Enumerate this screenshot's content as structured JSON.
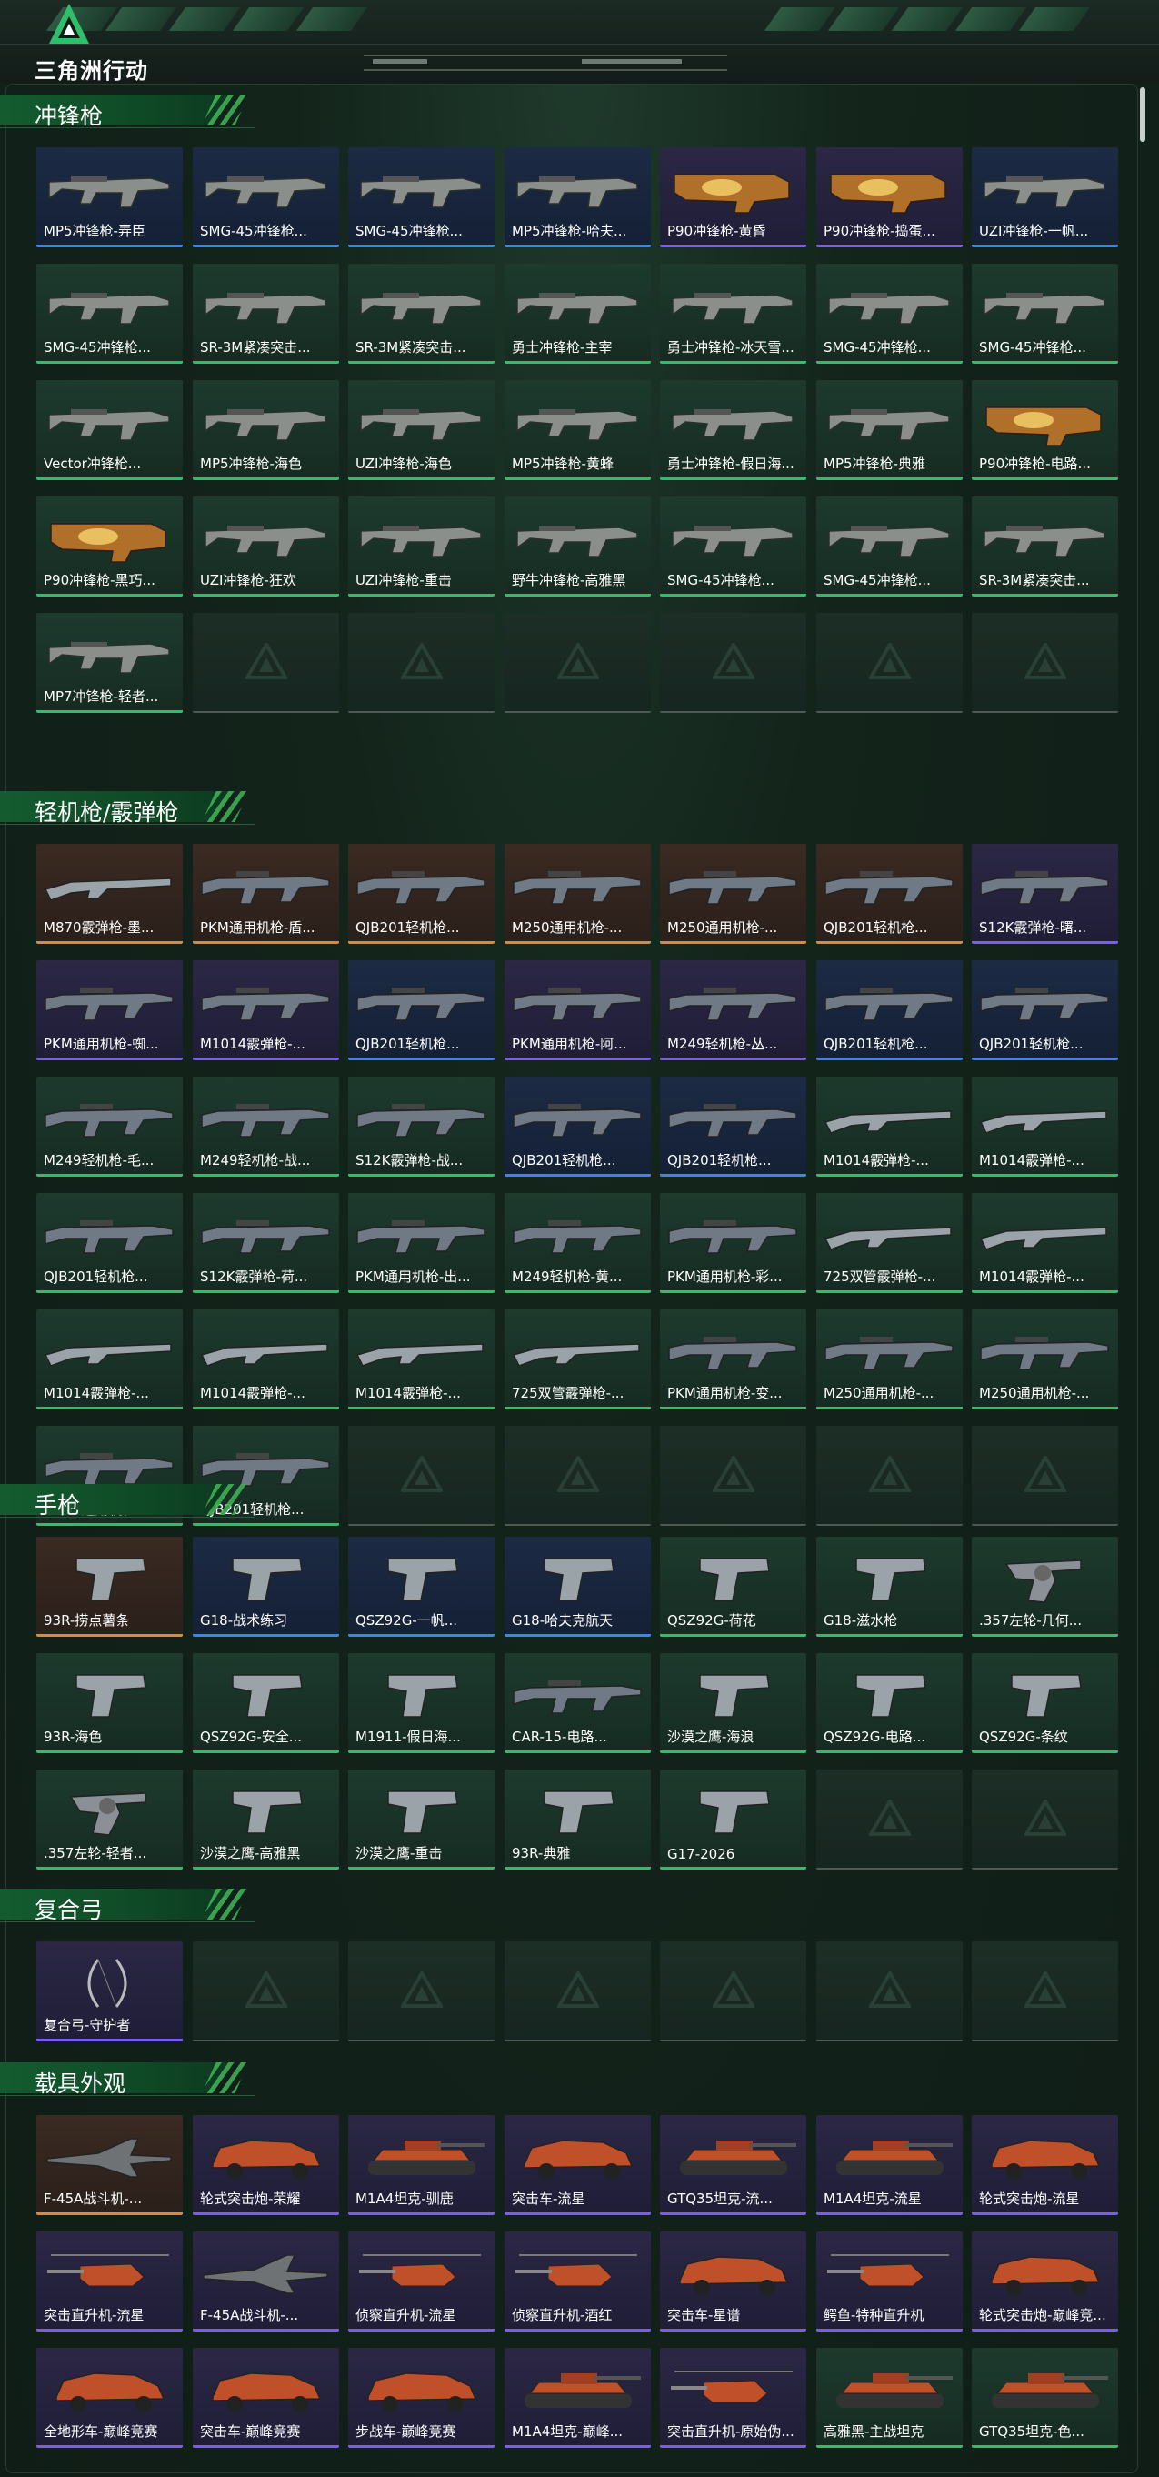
{
  "app": {
    "logo_text": "三角洲行动"
  },
  "colors": {
    "purple": "#7b5cf0",
    "blue": "#3d86e8",
    "gold": "#d98a3a",
    "green": "#2fbf6b"
  },
  "sections": [
    {
      "title": "冲锋枪",
      "items": [
        {
          "label": "MP5冲锋枪-弄臣",
          "rarity": "blue",
          "icon": "smg"
        },
        {
          "label": "SMG-45冲锋枪...",
          "rarity": "blue",
          "icon": "smg"
        },
        {
          "label": "SMG-45冲锋枪...",
          "rarity": "blue",
          "icon": "smg"
        },
        {
          "label": "MP5冲锋枪-哈夫...",
          "rarity": "blue",
          "icon": "smg"
        },
        {
          "label": "P90冲锋枪-黄昏",
          "rarity": "purple",
          "icon": "p90"
        },
        {
          "label": "P90冲锋枪-捣蛋...",
          "rarity": "purple",
          "icon": "p90"
        },
        {
          "label": "UZI冲锋枪-一帆...",
          "rarity": "blue",
          "icon": "smg"
        },
        {
          "label": "SMG-45冲锋枪...",
          "rarity": "green",
          "icon": "smg"
        },
        {
          "label": "SR-3M紧凑突击...",
          "rarity": "green",
          "icon": "smg"
        },
        {
          "label": "SR-3M紧凑突击...",
          "rarity": "green",
          "icon": "smg"
        },
        {
          "label": "勇士冲锋枪-主宰",
          "rarity": "green",
          "icon": "smg"
        },
        {
          "label": "勇士冲锋枪-冰天雪...",
          "rarity": "green",
          "icon": "smg"
        },
        {
          "label": "SMG-45冲锋枪...",
          "rarity": "green",
          "icon": "smg"
        },
        {
          "label": "SMG-45冲锋枪...",
          "rarity": "green",
          "icon": "smg"
        },
        {
          "label": "Vector冲锋枪...",
          "rarity": "green",
          "icon": "smg"
        },
        {
          "label": "MP5冲锋枪-海色",
          "rarity": "green",
          "icon": "smg"
        },
        {
          "label": "UZI冲锋枪-海色",
          "rarity": "green",
          "icon": "smg"
        },
        {
          "label": "MP5冲锋枪-黄蜂",
          "rarity": "green",
          "icon": "smg"
        },
        {
          "label": "勇士冲锋枪-假日海...",
          "rarity": "green",
          "icon": "smg"
        },
        {
          "label": "MP5冲锋枪-典雅",
          "rarity": "green",
          "icon": "smg"
        },
        {
          "label": "P90冲锋枪-电路...",
          "rarity": "green",
          "icon": "p90"
        },
        {
          "label": "P90冲锋枪-黑巧...",
          "rarity": "green",
          "icon": "p90"
        },
        {
          "label": "UZI冲锋枪-狂欢",
          "rarity": "green",
          "icon": "smg"
        },
        {
          "label": "UZI冲锋枪-重击",
          "rarity": "green",
          "icon": "smg"
        },
        {
          "label": "野牛冲锋枪-高雅黑",
          "rarity": "green",
          "icon": "smg"
        },
        {
          "label": "SMG-45冲锋枪...",
          "rarity": "green",
          "icon": "smg"
        },
        {
          "label": "SMG-45冲锋枪...",
          "rarity": "green",
          "icon": "smg"
        },
        {
          "label": "SR-3M紧凑突击...",
          "rarity": "green",
          "icon": "smg"
        },
        {
          "label": "MP7冲锋枪-轻者...",
          "rarity": "green",
          "icon": "smg"
        }
      ]
    },
    {
      "title": "轻机枪/霰弹枪",
      "items": [
        {
          "label": "M870霰弹枪-墨...",
          "rarity": "gold",
          "icon": "shotgun"
        },
        {
          "label": "PKM通用机枪-盾...",
          "rarity": "gold",
          "icon": "rifle"
        },
        {
          "label": "QJB201轻机枪...",
          "rarity": "gold",
          "icon": "rifle"
        },
        {
          "label": "M250通用机枪-...",
          "rarity": "gold",
          "icon": "rifle"
        },
        {
          "label": "M250通用机枪-...",
          "rarity": "gold",
          "icon": "rifle"
        },
        {
          "label": "QJB201轻机枪...",
          "rarity": "gold",
          "icon": "rifle"
        },
        {
          "label": "S12K霰弹枪-曙...",
          "rarity": "purple",
          "icon": "rifle"
        },
        {
          "label": "PKM通用机枪-蜘...",
          "rarity": "purple",
          "icon": "rifle"
        },
        {
          "label": "M1014霰弹枪-...",
          "rarity": "purple",
          "icon": "rifle"
        },
        {
          "label": "QJB201轻机枪...",
          "rarity": "blue",
          "icon": "rifle"
        },
        {
          "label": "PKM通用机枪-阿...",
          "rarity": "purple",
          "icon": "rifle"
        },
        {
          "label": "M249轻机枪-丛...",
          "rarity": "purple",
          "icon": "rifle"
        },
        {
          "label": "QJB201轻机枪...",
          "rarity": "blue",
          "icon": "rifle"
        },
        {
          "label": "QJB201轻机枪...",
          "rarity": "blue",
          "icon": "rifle"
        },
        {
          "label": "M249轻机枪-毛...",
          "rarity": "green",
          "icon": "rifle"
        },
        {
          "label": "M249轻机枪-战...",
          "rarity": "green",
          "icon": "rifle"
        },
        {
          "label": "S12K霰弹枪-战...",
          "rarity": "green",
          "icon": "rifle"
        },
        {
          "label": "QJB201轻机枪...",
          "rarity": "blue",
          "icon": "rifle"
        },
        {
          "label": "QJB201轻机枪...",
          "rarity": "blue",
          "icon": "rifle"
        },
        {
          "label": "M1014霰弹枪-...",
          "rarity": "green",
          "icon": "shotgun"
        },
        {
          "label": "M1014霰弹枪-...",
          "rarity": "green",
          "icon": "shotgun"
        },
        {
          "label": "QJB201轻机枪...",
          "rarity": "green",
          "icon": "rifle"
        },
        {
          "label": "S12K霰弹枪-荷...",
          "rarity": "green",
          "icon": "rifle"
        },
        {
          "label": "PKM通用机枪-出...",
          "rarity": "green",
          "icon": "rifle"
        },
        {
          "label": "M249轻机枪-黄...",
          "rarity": "green",
          "icon": "rifle"
        },
        {
          "label": "PKM通用机枪-彩...",
          "rarity": "green",
          "icon": "rifle"
        },
        {
          "label": "725双管霰弹枪-...",
          "rarity": "green",
          "icon": "shotgun"
        },
        {
          "label": "M1014霰弹枪-...",
          "rarity": "green",
          "icon": "shotgun"
        },
        {
          "label": "M1014霰弹枪-...",
          "rarity": "green",
          "icon": "shotgun"
        },
        {
          "label": "M1014霰弹枪-...",
          "rarity": "green",
          "icon": "shotgun"
        },
        {
          "label": "M1014霰弹枪-...",
          "rarity": "green",
          "icon": "shotgun"
        },
        {
          "label": "725双管霰弹枪-...",
          "rarity": "green",
          "icon": "shotgun"
        },
        {
          "label": "PKM通用机枪-变...",
          "rarity": "green",
          "icon": "rifle"
        },
        {
          "label": "M250通用机枪-...",
          "rarity": "green",
          "icon": "rifle"
        },
        {
          "label": "M250通用机枪-...",
          "rarity": "green",
          "icon": "rifle"
        },
        {
          "label": "M250通用机枪-...",
          "rarity": "green",
          "icon": "rifle"
        },
        {
          "label": "QJB201轻机枪...",
          "rarity": "green",
          "icon": "rifle"
        }
      ]
    },
    {
      "title": "手枪",
      "items": [
        {
          "label": "93R-捞点薯条",
          "rarity": "gold",
          "icon": "pistol"
        },
        {
          "label": "G18-战术练习",
          "rarity": "blue",
          "icon": "pistol"
        },
        {
          "label": "QSZ92G-一帆...",
          "rarity": "blue",
          "icon": "pistol"
        },
        {
          "label": "G18-哈夫克航天",
          "rarity": "blue",
          "icon": "pistol"
        },
        {
          "label": "QSZ92G-荷花",
          "rarity": "green",
          "icon": "pistol"
        },
        {
          "label": "G18-滋水枪",
          "rarity": "green",
          "icon": "pistol"
        },
        {
          "label": ".357左轮-几何...",
          "rarity": "green",
          "icon": "revolver"
        },
        {
          "label": "93R-海色",
          "rarity": "green",
          "icon": "pistol"
        },
        {
          "label": "QSZ92G-安全...",
          "rarity": "green",
          "icon": "pistol"
        },
        {
          "label": "M1911-假日海...",
          "rarity": "green",
          "icon": "pistol"
        },
        {
          "label": "CAR-15-电路...",
          "rarity": "green",
          "icon": "rifle"
        },
        {
          "label": "沙漠之鹰-海浪",
          "rarity": "green",
          "icon": "pistol"
        },
        {
          "label": "QSZ92G-电路...",
          "rarity": "green",
          "icon": "pistol"
        },
        {
          "label": "QSZ92G-条纹",
          "rarity": "green",
          "icon": "pistol"
        },
        {
          "label": ".357左轮-轻者...",
          "rarity": "green",
          "icon": "revolver"
        },
        {
          "label": "沙漠之鹰-高雅黑",
          "rarity": "green",
          "icon": "pistol"
        },
        {
          "label": "沙漠之鹰-重击",
          "rarity": "green",
          "icon": "pistol"
        },
        {
          "label": "93R-典雅",
          "rarity": "green",
          "icon": "pistol"
        },
        {
          "label": "G17-2026",
          "rarity": "green",
          "icon": "pistol"
        }
      ]
    },
    {
      "title": "复合弓",
      "items": [
        {
          "label": "复合弓-守护者",
          "rarity": "purple",
          "icon": "bow"
        }
      ]
    },
    {
      "title": "载具外观",
      "items": [
        {
          "label": "F-45A战斗机-...",
          "rarity": "gold",
          "icon": "jet"
        },
        {
          "label": "轮式突击炮-荣耀",
          "rarity": "purple",
          "icon": "car"
        },
        {
          "label": "M1A4坦克-驯鹿",
          "rarity": "purple",
          "icon": "tank"
        },
        {
          "label": "突击车-流星",
          "rarity": "purple",
          "icon": "car"
        },
        {
          "label": "GTQ35坦克-流...",
          "rarity": "purple",
          "icon": "tank"
        },
        {
          "label": "M1A4坦克-流星",
          "rarity": "purple",
          "icon": "tank"
        },
        {
          "label": "轮式突击炮-流星",
          "rarity": "purple",
          "icon": "car"
        },
        {
          "label": "突击直升机-流星",
          "rarity": "purple",
          "icon": "heli"
        },
        {
          "label": "F-45A战斗机-...",
          "rarity": "purple",
          "icon": "jet"
        },
        {
          "label": "侦察直升机-流星",
          "rarity": "purple",
          "icon": "heli"
        },
        {
          "label": "侦察直升机-酒红",
          "rarity": "purple",
          "icon": "heli"
        },
        {
          "label": "突击车-星谱",
          "rarity": "purple",
          "icon": "car"
        },
        {
          "label": "鳄鱼-特种直升机",
          "rarity": "purple",
          "icon": "heli"
        },
        {
          "label": "轮式突击炮-巅峰竞...",
          "rarity": "purple",
          "icon": "car"
        },
        {
          "label": "全地形车-巅峰竞赛",
          "rarity": "purple",
          "icon": "car"
        },
        {
          "label": "突击车-巅峰竞赛",
          "rarity": "purple",
          "icon": "car"
        },
        {
          "label": "步战车-巅峰竞赛",
          "rarity": "purple",
          "icon": "car"
        },
        {
          "label": "M1A4坦克-巅峰...",
          "rarity": "purple",
          "icon": "tank"
        },
        {
          "label": "突击直升机-原始伪...",
          "rarity": "purple",
          "icon": "heli"
        },
        {
          "label": "高雅黑-主战坦克",
          "rarity": "green",
          "icon": "tank"
        },
        {
          "label": "GTQ35坦克-色...",
          "rarity": "green",
          "icon": "tank"
        }
      ]
    }
  ]
}
